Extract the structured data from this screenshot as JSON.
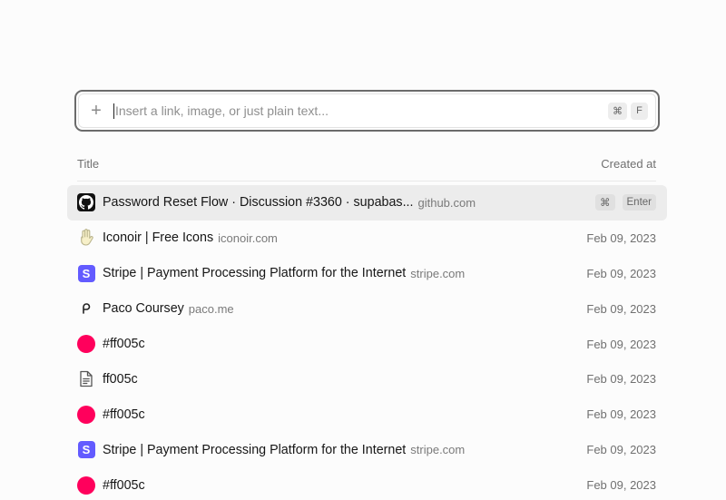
{
  "input": {
    "placeholder": "Insert a link, image, or just plain text...",
    "plus_icon": "plus-icon",
    "shortcut": [
      "⌘",
      "F"
    ]
  },
  "table": {
    "col_title": "Title",
    "col_created": "Created at",
    "selected_keys": [
      "⌘",
      "Enter"
    ]
  },
  "rows": [
    {
      "icon": "github-icon",
      "title": "Password Reset Flow · Discussion #3360 · supabas...",
      "domain": "github.com",
      "date": ""
    },
    {
      "icon": "iconoir-hand-icon",
      "title": "Iconoir | Free Icons",
      "domain": "iconoir.com",
      "date": "Feb 09, 2023"
    },
    {
      "icon": "stripe-icon",
      "title": "Stripe | Payment Processing Platform for the Internet",
      "domain": "stripe.com",
      "date": "Feb 09, 2023"
    },
    {
      "icon": "paco-icon",
      "title": "Paco Coursey",
      "domain": "paco.me",
      "date": "Feb 09, 2023"
    },
    {
      "icon": "color-dot-icon",
      "color": "#ff005c",
      "title": "#ff005c",
      "domain": "",
      "date": "Feb 09, 2023"
    },
    {
      "icon": "document-icon",
      "title": "ff005c",
      "domain": "",
      "date": "Feb 09, 2023"
    },
    {
      "icon": "color-dot-icon",
      "color": "#ff005c",
      "title": "#ff005c",
      "domain": "",
      "date": "Feb 09, 2023"
    },
    {
      "icon": "stripe-icon",
      "title": "Stripe | Payment Processing Platform for the Internet",
      "domain": "stripe.com",
      "date": "Feb 09, 2023"
    },
    {
      "icon": "color-dot-icon",
      "color": "#ff005c",
      "title": "#ff005c",
      "domain": "",
      "date": "Feb 09, 2023"
    }
  ],
  "colors": {
    "accent_dot": "#ff005c",
    "stripe": "#635bff",
    "selected_row": "#ececec"
  }
}
